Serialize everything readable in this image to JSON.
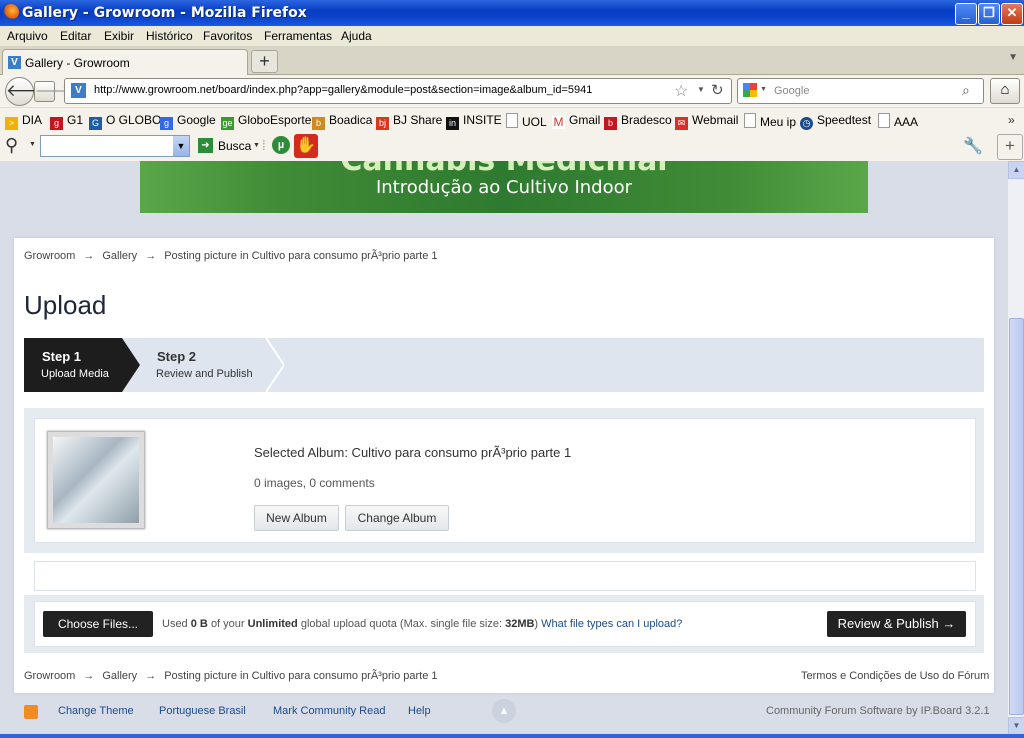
{
  "window": {
    "title": "Gallery - Growroom - Mozilla Firefox"
  },
  "menu": [
    "Arquivo",
    "Editar",
    "Exibir",
    "Histórico",
    "Favoritos",
    "Ferramentas",
    "Ajuda"
  ],
  "tab": {
    "label": "Gallery - Growroom",
    "new_tab": "+"
  },
  "nav": {
    "url": "http://www.growroom.net/board/index.php?app=gallery&module=post&section=image&album_id=5941",
    "search_placeholder": "Google"
  },
  "bookmarks": [
    {
      "label": "DIA",
      "color": "#f2b100"
    },
    {
      "label": "G1",
      "color": "#c4161c"
    },
    {
      "label": "O GLOBO",
      "color": "#1b5da8"
    },
    {
      "label": "Google",
      "color": "#3369e8"
    },
    {
      "label": "GloboEsporte",
      "color": "#3a9a2e"
    },
    {
      "label": "Boadica",
      "color": "#d08a22"
    },
    {
      "label": "BJ Share",
      "color": "#d43a1e"
    },
    {
      "label": "INSITE",
      "color": "#111111"
    },
    {
      "label": "UOL",
      "color": "#ffffff"
    },
    {
      "label": "Gmail",
      "color": "#d93025"
    },
    {
      "label": "Bradesco",
      "color": "#c4161c"
    },
    {
      "label": "Webmail",
      "color": "#d93025"
    },
    {
      "label": "Meu ip",
      "color": "#ffffff"
    },
    {
      "label": "Speedtest",
      "color": "#1c4b8a"
    },
    {
      "label": "AAA",
      "color": "#ffffff"
    }
  ],
  "toolbar2": {
    "busca": "Busca"
  },
  "banner": {
    "line1": "Cannabis Medicinal",
    "line2": "Introdução ao Cultivo Indoor"
  },
  "breadcrumb": {
    "items": [
      "Growroom",
      "Gallery",
      "Posting picture in Cultivo para consumo prÃ³prio parte 1"
    ],
    "arrow": "→"
  },
  "page": {
    "title": "Upload"
  },
  "steps": [
    {
      "title": "Step 1",
      "subtitle": "Upload Media"
    },
    {
      "title": "Step 2",
      "subtitle": "Review and Publish"
    }
  ],
  "album": {
    "selected": "Selected Album: Cultivo para consumo prÃ³prio parte 1",
    "stats": "0 images, 0 comments",
    "new_album": "New Album",
    "change_album": "Change Album"
  },
  "upload": {
    "choose_files": "Choose Files...",
    "quota_prefix": "Used",
    "quota_used": "0 B",
    "quota_mid": "of your",
    "quota_total": "Unlimited",
    "quota_mid2": "global upload quota (Max. single file size:",
    "max_size": "32MB",
    "quota_suffix": ")",
    "file_types_link": "What file types can I upload?",
    "review_publish": "Review & Publish →"
  },
  "bottom": {
    "terms": "Termos e Condições de Uso do Fórum"
  },
  "footer": {
    "change_theme": "Change Theme",
    "language": "Portuguese Brasil",
    "mark_read": "Mark Community Read",
    "help": "Help",
    "credit": "Community Forum Software by IP.Board 3.2.1"
  }
}
